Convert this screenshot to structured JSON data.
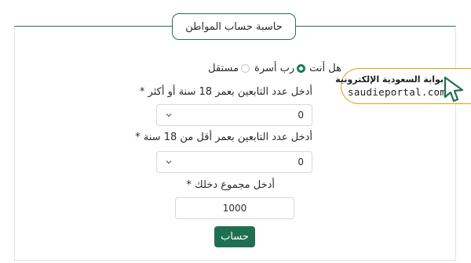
{
  "calculator": {
    "title": "حاسبة حساب المواطن",
    "question": "هل أنت",
    "options": [
      "رب أسرة",
      "مستقل"
    ],
    "selected_option": "رب أسرة",
    "adult_dependents_label": "أدخل عدد التابعين بعمر 18 سنة أو أكثر *",
    "adult_dependents_value": "0",
    "minor_dependents_label": "أدخل عدد التابعين بعمر أقل من 18 سنة *",
    "minor_dependents_value": "0",
    "income_label": "أدخل مجموع دخلك *",
    "income_value": "1000",
    "submit_label": "حساب"
  },
  "branding": {
    "name_ar": "بوابة السعودية الإلكترونية",
    "domain": "saudieportal.com",
    "icon": "cursor-icon"
  },
  "colors": {
    "accent": "#1f6f53",
    "border": "#2e6b55",
    "logo_border": "#e0a000"
  }
}
